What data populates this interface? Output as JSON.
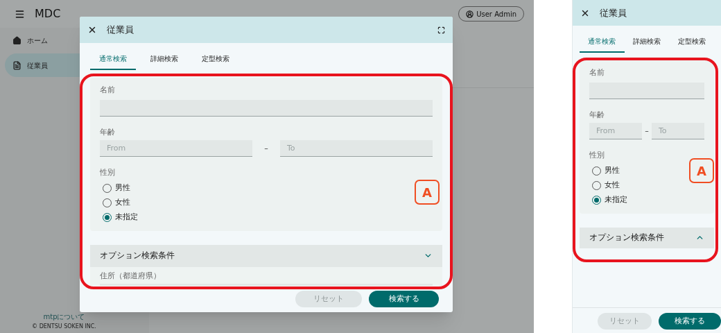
{
  "app": {
    "title": "MDC",
    "user_button": "User Admin",
    "nav": [
      {
        "label": "ホーム",
        "selected": false
      },
      {
        "label": "従業員",
        "selected": true
      }
    ],
    "footer_link": "mtpについて",
    "copyright": "© DENTSU SOKEN INC."
  },
  "views": [
    {
      "title": "従業員",
      "maximize": true,
      "tabs": [
        {
          "label": "通常検索",
          "selected": true
        },
        {
          "label": "詳細検索",
          "selected": false
        },
        {
          "label": "定型検索",
          "selected": false
        }
      ],
      "fields": [
        {
          "kind": "text",
          "label": "名前"
        },
        {
          "kind": "range",
          "label": "年齢",
          "from_placeholder": "From",
          "to_placeholder": "To",
          "separator": "–"
        },
        {
          "kind": "radio",
          "label": "性別",
          "options": [
            {
              "label": "男性",
              "selected": false
            },
            {
              "label": "女性",
              "selected": false
            },
            {
              "label": "未指定",
              "selected": true
            }
          ]
        }
      ],
      "accordion": {
        "label": "オプション検索条件",
        "expanded": false,
        "fields": [
          {
            "label": "住所（都道府県）"
          }
        ]
      },
      "buttons": [
        {
          "label": "リセット",
          "kind": "secondary"
        },
        {
          "label": "検索する",
          "kind": "primary"
        }
      ],
      "annotation": "A"
    },
    {
      "title": "従業員",
      "maximize": false,
      "tabs": [
        {
          "label": "通常検索",
          "selected": true
        },
        {
          "label": "詳細検索",
          "selected": false
        },
        {
          "label": "定型検索",
          "selected": false
        }
      ],
      "fields": [
        {
          "kind": "text",
          "label": "名前"
        },
        {
          "kind": "range",
          "label": "年齢",
          "from_placeholder": "From",
          "to_placeholder": "To",
          "separator": "–"
        },
        {
          "kind": "radio",
          "label": "性別",
          "options": [
            {
              "label": "男性",
              "selected": false
            },
            {
              "label": "女性",
              "selected": false
            },
            {
              "label": "未指定",
              "selected": true
            }
          ]
        }
      ],
      "accordion": {
        "label": "オプション検索条件",
        "expanded": true
      },
      "buttons": [
        {
          "label": "リセット",
          "kind": "secondary"
        },
        {
          "label": "検索する",
          "kind": "primary"
        }
      ],
      "annotation": "A"
    }
  ]
}
